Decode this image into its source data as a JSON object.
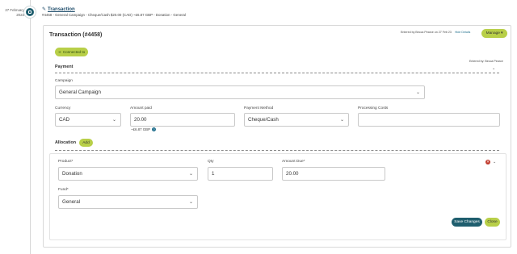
{
  "timeline": {
    "date_line1": "27 February",
    "date_line2": "2023"
  },
  "entry": {
    "title": "Transaction",
    "summary": "#4458 - General Campaign - Cheque/Cash $20.00 (CAD) ~£6.87 GBP - Donation - General"
  },
  "card": {
    "title": "Transaction (#4458)",
    "entered_by": "Entered by Becca Pearce on 27 Feb 23",
    "hide_details": "Hide Details",
    "manage_label": "Manage",
    "connected_label": "Connected to",
    "entered_by_short": "Entered by: Becca Pearce"
  },
  "payment": {
    "section_label": "Payment",
    "campaign_label": "Campaign",
    "campaign_value": "General Campaign",
    "currency_label": "Currency",
    "currency_value": "CAD",
    "amount_label": "Amount paid",
    "amount_value": "20.00",
    "gbp_value": "~£6.87 GBP",
    "method_label": "Payment Method",
    "method_value": "Cheque/Cash",
    "costs_label": "Processing Costs",
    "costs_value": ""
  },
  "allocation": {
    "section_label": "Allocation",
    "add_label": "Add",
    "product_label": "Product*",
    "product_value": "Donation",
    "qty_label": "Qty",
    "qty_value": "1",
    "amount_due_label": "Amount Due*",
    "amount_due_value": "20.00",
    "fund_label": "Fund*",
    "fund_value": "General"
  },
  "actions": {
    "save_label": "Save Changes",
    "close_label": "Close"
  },
  "colors": {
    "accent_green": "#b8cf48",
    "primary_teal": "#1f5e6e",
    "delete_red": "#c0392b"
  }
}
